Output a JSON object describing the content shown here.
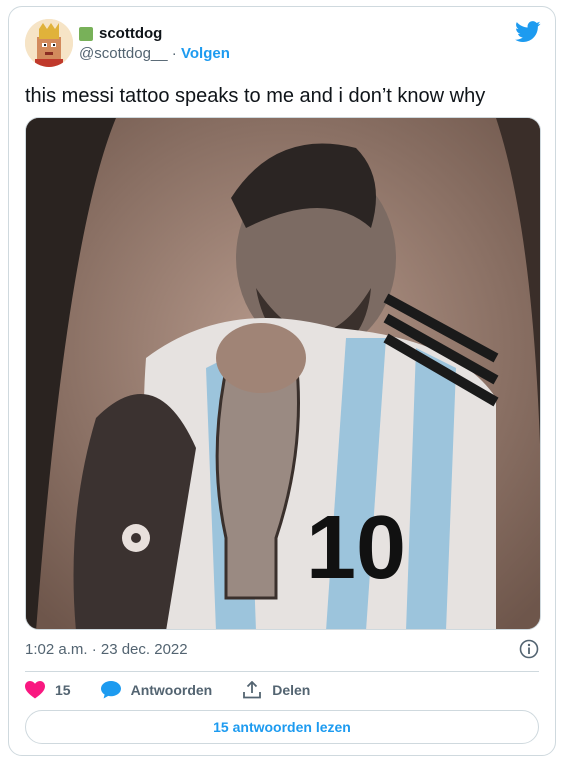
{
  "tweet": {
    "display_name": "scottdog",
    "handle": "@scottdog__",
    "separator": "·",
    "follow_label": "Volgen",
    "text": "this messi tattoo speaks to me and i don’t know why",
    "timestamp": "1:02 a.m. · 23 dec. 2022"
  },
  "actions": {
    "likes": "15",
    "reply_label": "Antwoorden",
    "share_label": "Delen"
  },
  "read_replies_label": "15 antwoorden lezen",
  "icons": {
    "brand": "twitter-bird-icon",
    "verified_badge": "green-square-badge",
    "like": "heart-icon",
    "reply": "speech-bubble-icon",
    "share": "share-arrow-icon",
    "info": "info-icon"
  },
  "colors": {
    "accent": "#1d9bf0",
    "like": "#f91880",
    "muted": "#536471",
    "badge": "#78b159"
  }
}
